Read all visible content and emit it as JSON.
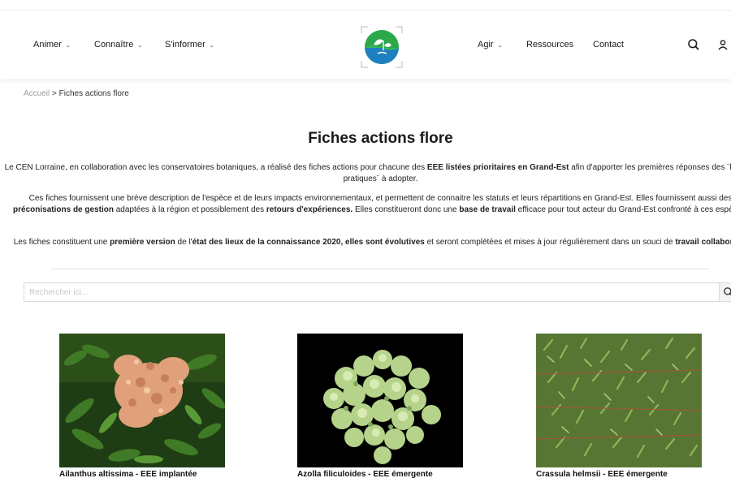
{
  "nav": {
    "left": [
      {
        "label": "Animer"
      },
      {
        "label": "Connaître"
      },
      {
        "label": "S'informer"
      }
    ],
    "right": [
      {
        "label": "Agir",
        "dropdown": true
      },
      {
        "label": "Ressources",
        "dropdown": false
      },
      {
        "label": "Contact",
        "dropdown": false
      }
    ],
    "icons": [
      "search-icon",
      "user-icon"
    ]
  },
  "breadcrumb": {
    "home": "Accueil",
    "separator": " > ",
    "current": "Fiches actions flore"
  },
  "page": {
    "title": "Fiches actions flore",
    "p1": {
      "a": "Le CEN Lorraine, en collaboration avec les conservatoires botaniques, a réalisé des fiches actions pour chacune des ",
      "b1": "EEE listées prioritaires en Grand-Est",
      "c": " afin d'apporter les premières réponses des ¨bonnes pratiques¨ à adopter."
    },
    "p2": {
      "a": "Ces fiches fournissent une brève description de l'espèce et de leurs impacts environnementaux, et permettent de connaitre les statuts et leurs répartitions en Grand-Est. Elles fournissent aussi des ",
      "b1": "préconisations de gestion",
      "c": " adaptées à la région et possiblement des ",
      "b2": "retours d'expériences.",
      "d": " Elles constitueront donc une ",
      "b3": "base de travail",
      "e": " efficace pour tout acteur du Grand-Est confronté à ces espèces."
    },
    "p3": {
      "a": "Les fiches constituent une ",
      "b1": "première version",
      "c": " de l'",
      "b2": "état des lieux de la connaissance 2020, elles sont évolutives",
      "d": " et seront complétées et mises à jour régulièrement dans un souci de ",
      "b3": "travail collaboratif",
      "e": "."
    }
  },
  "search": {
    "placeholder": "Rechercher ici..."
  },
  "cards": [
    {
      "caption": "Ailanthus altissima - EEE implantée"
    },
    {
      "caption": "Azolla filiculoides - EEE émergente"
    },
    {
      "caption": "Crassula helmsii - EEE émergente"
    }
  ],
  "colors": {
    "logo_green": "#2aa84a",
    "logo_blue": "#1e7fc0",
    "text": "#1a1a1a",
    "muted": "#9a9a9a"
  }
}
